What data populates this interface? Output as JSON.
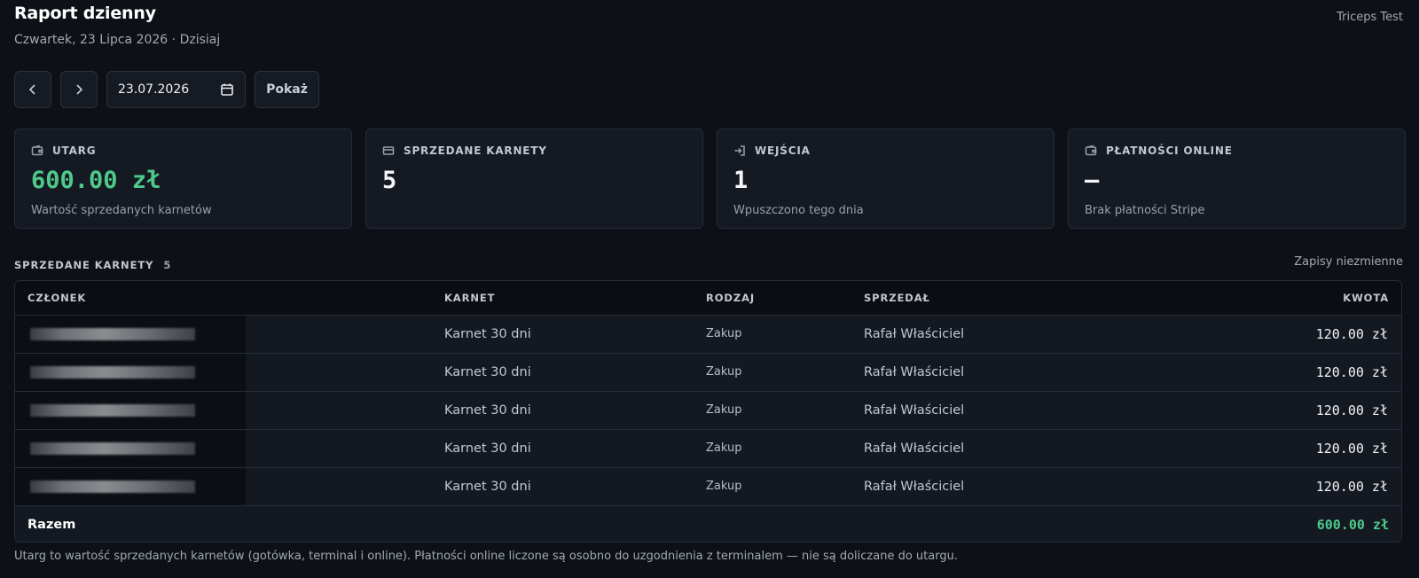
{
  "header": {
    "title": "Raport dzienny",
    "subtitle": "Czwartek, 23 Lipca 2026 · Dzisiaj",
    "account": "Triceps Test"
  },
  "toolbar": {
    "date_value": "23.07.2026",
    "show_label": "Pokaż"
  },
  "stats": [
    {
      "label": "UTARG",
      "value": "600.00 zł",
      "caption": "Wartość sprzedanych karnetów",
      "icon": "wallet-icon"
    },
    {
      "label": "SPRZEDANE KARNETY",
      "value": "5",
      "caption": "",
      "icon": "card-icon"
    },
    {
      "label": "WEJŚCIA",
      "value": "1",
      "caption": "Wpuszczono tego dnia",
      "icon": "login-icon"
    },
    {
      "label": "PŁATNOŚCI ONLINE",
      "value": "—",
      "caption": "Brak płatności Stripe",
      "icon": "wallet-icon"
    }
  ],
  "accent_color": "#4ec98a",
  "section": {
    "title": "SPRZEDANE KARNETY",
    "count": "5",
    "note": "Zapisy niezmienne"
  },
  "table": {
    "columns": [
      "CZŁONEK",
      "KARNET",
      "RODZAJ",
      "SPRZEDAŁ",
      "KWOTA"
    ],
    "rows": [
      {
        "member": "",
        "pass": "Karnet 30 dni",
        "kind": "Zakup",
        "seller": "Rafał Właściciel",
        "amount": "120.00 zł"
      },
      {
        "member": "",
        "pass": "Karnet 30 dni",
        "kind": "Zakup",
        "seller": "Rafał Właściciel",
        "amount": "120.00 zł"
      },
      {
        "member": "",
        "pass": "Karnet 30 dni",
        "kind": "Zakup",
        "seller": "Rafał Właściciel",
        "amount": "120.00 zł"
      },
      {
        "member": "",
        "pass": "Karnet 30 dni",
        "kind": "Zakup",
        "seller": "Rafał Właściciel",
        "amount": "120.00 zł"
      },
      {
        "member": "",
        "pass": "Karnet 30 dni",
        "kind": "Zakup",
        "seller": "Rafał Właściciel",
        "amount": "120.00 zł"
      }
    ],
    "total_label": "Razem",
    "total_value": "600.00 zł"
  },
  "footnote": "Utarg to wartość sprzedanych karnetów (gotówka, terminal i online). Płatności online liczone są osobno do uzgodnienia z terminalem — nie są doliczane do utargu."
}
